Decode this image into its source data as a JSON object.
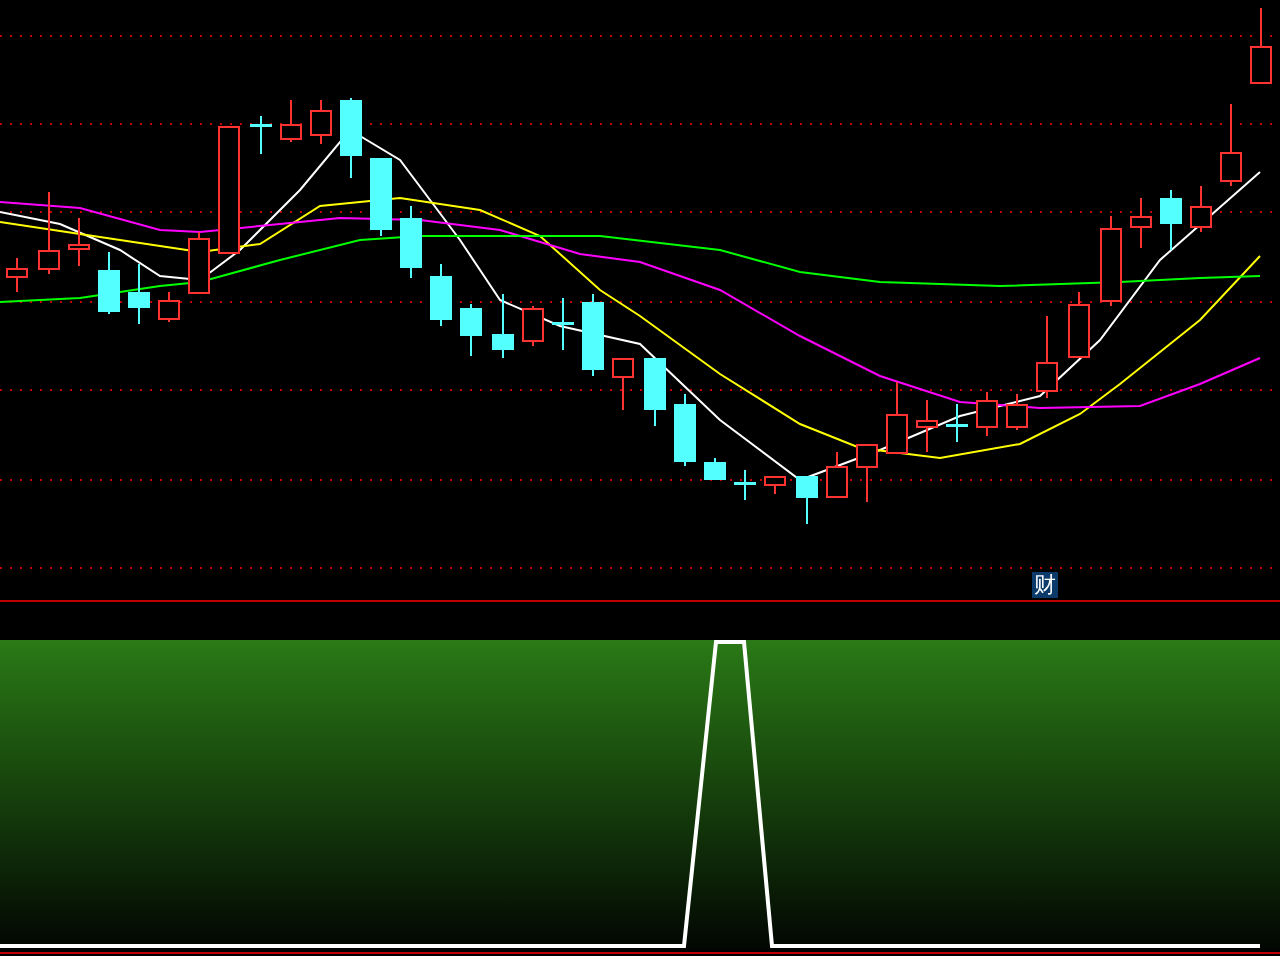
{
  "chart_marker": {
    "label": "财"
  }
}
